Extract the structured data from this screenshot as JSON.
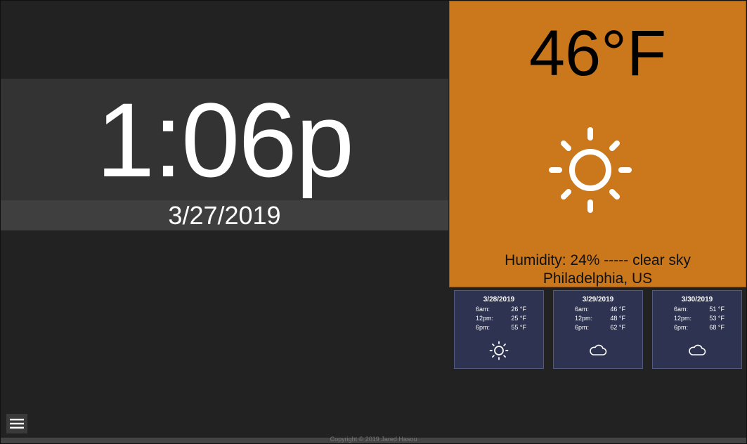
{
  "clock": {
    "time": "1:06p",
    "date": "3/27/2019"
  },
  "current_weather": {
    "temperature": "46°F",
    "icon": "sun-icon",
    "description": "Humidity: 24% ----- clear sky",
    "location": "Philadelphia, US",
    "panel_color": "#cb771c"
  },
  "forecast": [
    {
      "date": "3/28/2019",
      "rows": [
        {
          "label": "6am:",
          "temp": "26 °F"
        },
        {
          "label": "12pm:",
          "temp": "25 °F"
        },
        {
          "label": "6pm:",
          "temp": "55 °F"
        }
      ],
      "icon": "sun-icon"
    },
    {
      "date": "3/29/2019",
      "rows": [
        {
          "label": "6am:",
          "temp": "46 °F"
        },
        {
          "label": "12pm:",
          "temp": "48 °F"
        },
        {
          "label": "6pm:",
          "temp": "62 °F"
        }
      ],
      "icon": "cloud-icon"
    },
    {
      "date": "3/30/2019",
      "rows": [
        {
          "label": "6am:",
          "temp": "51 °F"
        },
        {
          "label": "12pm:",
          "temp": "53 °F"
        },
        {
          "label": "6pm:",
          "temp": "68 °F"
        }
      ],
      "icon": "cloud-icon"
    }
  ],
  "menu": {
    "icon": "hamburger-menu-icon"
  },
  "footer": {
    "copyright": "Copyright © 2019 Jared Hasou"
  }
}
